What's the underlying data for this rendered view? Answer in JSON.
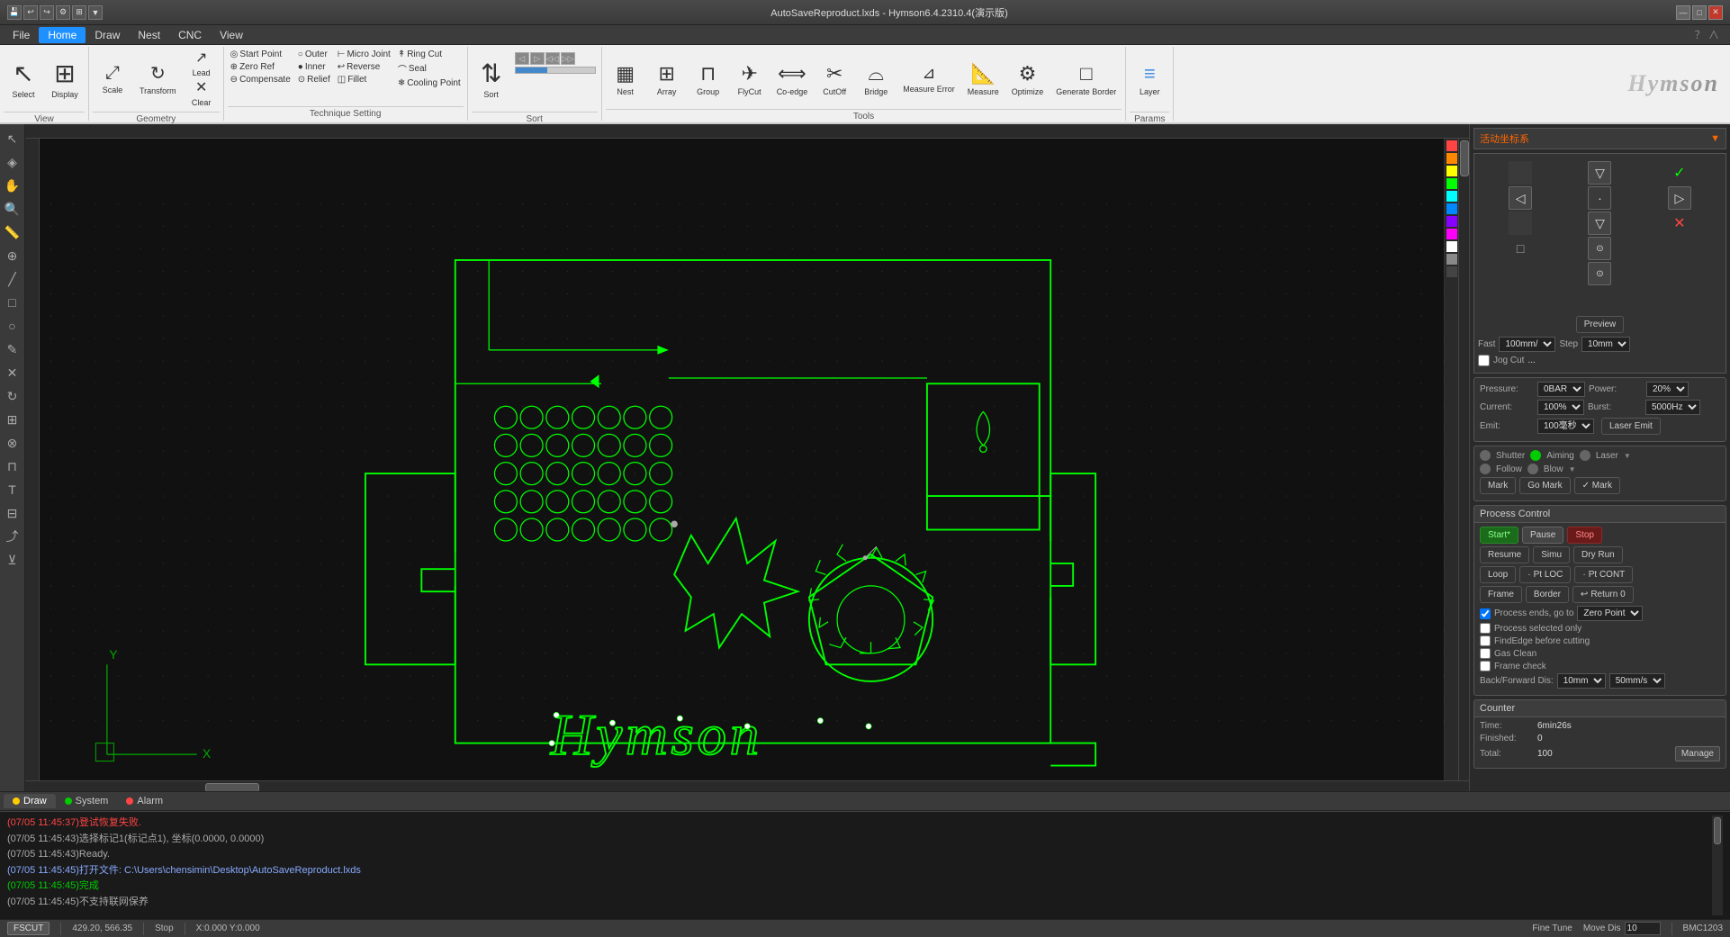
{
  "titlebar": {
    "title": "AutoSaveReproduct.lxds - Hymson6.4.2310.4(演示版)",
    "min": "—",
    "max": "□",
    "close": "✕"
  },
  "menubar": {
    "items": [
      "File",
      "Home",
      "Draw",
      "Nest",
      "CNC",
      "View"
    ]
  },
  "ribbon": {
    "view_section": {
      "label": "View",
      "buttons": [
        {
          "id": "select",
          "label": "Select",
          "icon": "↖"
        },
        {
          "id": "display",
          "label": "Display",
          "icon": "⊞"
        }
      ]
    },
    "geometry_section": {
      "label": "Geometry",
      "buttons": [
        {
          "id": "scale",
          "label": "Scale",
          "icon": "⤢"
        },
        {
          "id": "transform",
          "label": "Transform",
          "icon": "↻"
        }
      ],
      "sub_buttons": [
        {
          "id": "lead",
          "label": "Lead",
          "icon": "↗"
        },
        {
          "id": "clear",
          "label": "Clear",
          "icon": "✕"
        }
      ]
    },
    "technique_section": {
      "label": "Technique Setting",
      "buttons": [
        {
          "id": "start_point",
          "label": "Start Point",
          "icon": "◎"
        },
        {
          "id": "outer",
          "label": "Outer",
          "icon": "○"
        },
        {
          "id": "inner",
          "label": "Inner",
          "icon": "●"
        },
        {
          "id": "zero_ref",
          "label": "Zero Ref",
          "icon": "⊕"
        },
        {
          "id": "compensate",
          "label": "Compensate",
          "icon": "⊖"
        },
        {
          "id": "micro_joint",
          "label": "Micro Joint",
          "icon": "⊢"
        },
        {
          "id": "reverse",
          "label": "Reverse",
          "icon": "↩"
        },
        {
          "id": "ring_cut",
          "label": "Ring Cut",
          "icon": "⊙"
        },
        {
          "id": "seal",
          "label": "Seal",
          "icon": "◫"
        },
        {
          "id": "relief",
          "label": "Relief",
          "icon": "↟"
        },
        {
          "id": "fillet",
          "label": "Fillet",
          "icon": "⌒"
        },
        {
          "id": "cooling_point",
          "label": "Cooling Point",
          "icon": "❄"
        }
      ]
    },
    "sort_section": {
      "label": "Sort",
      "buttons": [
        {
          "id": "sort",
          "label": "Sort",
          "icon": "⇅"
        }
      ]
    },
    "tools_section": {
      "label": "Tools",
      "buttons": [
        {
          "id": "nest",
          "label": "Nest",
          "icon": "▦"
        },
        {
          "id": "array",
          "label": "Array",
          "icon": "⊞"
        },
        {
          "id": "group",
          "label": "Group",
          "icon": "⊓"
        },
        {
          "id": "flycut",
          "label": "FlyCut",
          "icon": "✈"
        },
        {
          "id": "co_edge",
          "label": "Co-edge",
          "icon": "⟺"
        },
        {
          "id": "cutoff",
          "label": "CutOff",
          "icon": "✂"
        },
        {
          "id": "bridge",
          "label": "Bridge",
          "icon": "⌓"
        },
        {
          "id": "measure_error",
          "label": "Measure Error",
          "icon": "⊿"
        },
        {
          "id": "measure",
          "label": "Measure",
          "icon": "📐"
        },
        {
          "id": "optimize",
          "label": "Optimize",
          "icon": "⚙"
        },
        {
          "id": "generate_border",
          "label": "Generate Border",
          "icon": "□"
        }
      ]
    },
    "params_section": {
      "label": "Params",
      "buttons": [
        {
          "id": "layer",
          "label": "Layer",
          "icon": "≡"
        }
      ]
    }
  },
  "right_panel": {
    "coord_system": "活动坐标系",
    "preview_label": "Preview",
    "fast_label": "Fast",
    "fast_value": "100mm/",
    "step_label": "Step",
    "step_value": "10mm",
    "jog_cut_label": "Jog Cut",
    "jog_cut_value": "...",
    "pressure_label": "Pressure:",
    "pressure_value": "0BAR",
    "power_label": "Power:",
    "power_value": "20%",
    "current_label": "Current:",
    "current_value": "100%",
    "burst_label": "Burst:",
    "burst_value": "5000Hz",
    "emit_label": "Emit:",
    "emit_value": "100毫秒",
    "laser_emit_label": "Laser Emit",
    "shutter_label": "Shutter",
    "aiming_label": "Aiming",
    "laser_label": "Laser",
    "follow_label": "Follow",
    "blow_label": "Blow",
    "mark_label": "Mark",
    "go_mark_label": "Go Mark",
    "mark2_label": "✓ Mark",
    "process_control_label": "Process Control",
    "start_label": "Start*",
    "pause_label": "Pause",
    "stop_label": "Stop",
    "resume_label": "Resume",
    "simu_label": "Simu",
    "dry_run_label": "Dry Run",
    "loop_label": "Loop",
    "pt_loc_label": "Pt LOC",
    "pt_cont_label": "Pt CONT",
    "frame_label": "Frame",
    "border_label": "Border",
    "return_0_label": "Return 0",
    "process_ends_label": "Process ends, go to",
    "zero_point_label": "Zero Point",
    "process_selected_only": "Process selected only",
    "find_edge_label": "FindEdge before cutting",
    "gas_clean_label": "Gas Clean",
    "frame_check_label": "Frame check",
    "back_forward_label": "Back/Forward Dis:",
    "back_forward_val1": "10mm",
    "back_forward_val2": "50mm/s",
    "counter_label": "Counter",
    "time_label": "Time:",
    "time_value": "6min26s",
    "finished_label": "Finished:",
    "finished_value": "0",
    "total_label": "Total:",
    "total_value": "100",
    "manage_label": "Manage"
  },
  "bottom_tabs": [
    {
      "id": "draw",
      "label": "Draw",
      "dot": "yellow"
    },
    {
      "id": "system",
      "label": "System",
      "dot": "green"
    },
    {
      "id": "alarm",
      "label": "Alarm",
      "dot": "red"
    }
  ],
  "log_lines": [
    {
      "type": "error",
      "text": "(07/05 11:45:37)登试恢复失败."
    },
    {
      "type": "normal",
      "text": "(07/05 11:45:43)选择标记1(标记点1), 坐标(0.0000, 0.0000)"
    },
    {
      "type": "normal",
      "text": "(07/05 11:45:43)Ready."
    },
    {
      "type": "link",
      "text": "(07/05 11:45:45)打开文件: C:\\Users\\chensimin\\Desktop\\AutoSaveReproduct.lxds"
    },
    {
      "type": "highlight",
      "text": "(07/05 11:45:45)完成"
    },
    {
      "type": "normal",
      "text": "(07/05 11:45:45)不支持联网保养"
    }
  ],
  "statusbar": {
    "coordinates": "429.20, 566.35",
    "stop_label": "Stop",
    "xy_coords": "X:0.000 Y:0.000",
    "fine_tune_label": "Fine Tune",
    "move_dis_label": "Move Dis",
    "move_dis_value": "10",
    "bmc_label": "BMC1203",
    "fscut_label": "FSCUT"
  },
  "colors": {
    "canvas_bg": "#111111",
    "accent_green": "#00ff00",
    "panel_bg": "#2a2a2a",
    "header_bg": "#3c3c3c"
  }
}
